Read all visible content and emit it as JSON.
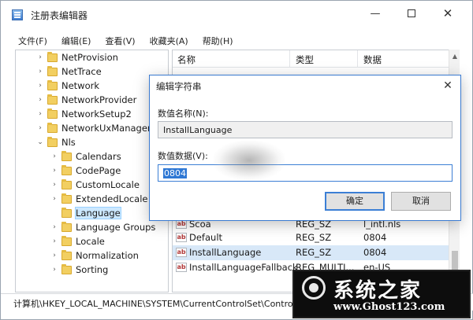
{
  "window": {
    "title": "注册表编辑器",
    "minimize": "—",
    "close": "✕"
  },
  "menu": [
    "文件(F)",
    "编辑(E)",
    "查看(V)",
    "收藏夹(A)",
    "帮助(H)"
  ],
  "tree": {
    "items": [
      {
        "label": "NetProvision",
        "expanded": false,
        "level": 1
      },
      {
        "label": "NetTrace",
        "expanded": false,
        "level": 1
      },
      {
        "label": "Network",
        "expanded": false,
        "level": 1
      },
      {
        "label": "NetworkProvider",
        "expanded": false,
        "level": 1
      },
      {
        "label": "NetworkSetup2",
        "expanded": false,
        "level": 1
      },
      {
        "label": "NetworkUxManager",
        "expanded": false,
        "level": 1
      },
      {
        "label": "Nls",
        "expanded": true,
        "level": 1
      },
      {
        "label": "Calendars",
        "expanded": false,
        "level": 2
      },
      {
        "label": "CodePage",
        "expanded": false,
        "level": 2
      },
      {
        "label": "CustomLocale",
        "expanded": false,
        "level": 2
      },
      {
        "label": "ExtendedLocale",
        "expanded": false,
        "level": 2
      },
      {
        "label": "Language",
        "expanded": false,
        "level": 2,
        "selected": true
      },
      {
        "label": "Language Groups",
        "expanded": false,
        "level": 2
      },
      {
        "label": "Locale",
        "expanded": false,
        "level": 2
      },
      {
        "label": "Normalization",
        "expanded": false,
        "level": 2
      },
      {
        "label": "Sorting",
        "expanded": false,
        "level": 2
      }
    ]
  },
  "list": {
    "columns": [
      "名称",
      "类型",
      "数据"
    ],
    "rows": [
      {
        "name": "Scoa",
        "type": "REG_SZ",
        "data": "l_intl.nls"
      },
      {
        "name": "Default",
        "type": "REG_SZ",
        "data": "0804"
      },
      {
        "name": "InstallLanguage",
        "type": "REG_SZ",
        "data": "0804",
        "selected": true
      },
      {
        "name": "InstallLanguageFallback",
        "type": "REG_MULTI...",
        "data": "en-US"
      }
    ]
  },
  "statusbar": {
    "path": "计算机\\HKEY_LOCAL_MACHINE\\SYSTEM\\CurrentControlSet\\Control\\"
  },
  "dialog": {
    "title": "编辑字符串",
    "close": "✕",
    "name_label": "数值名称(N):",
    "name_value": "InstallLanguage",
    "data_label": "数值数据(V):",
    "data_value": "0804",
    "ok": "确定",
    "cancel": "取消"
  },
  "watermark": {
    "title": "系统之家",
    "url": "www.Ghost123.com"
  },
  "colors": {
    "accent": "#3c7fd5",
    "selection": "#2f78d4",
    "folder": "#f2cf61"
  }
}
